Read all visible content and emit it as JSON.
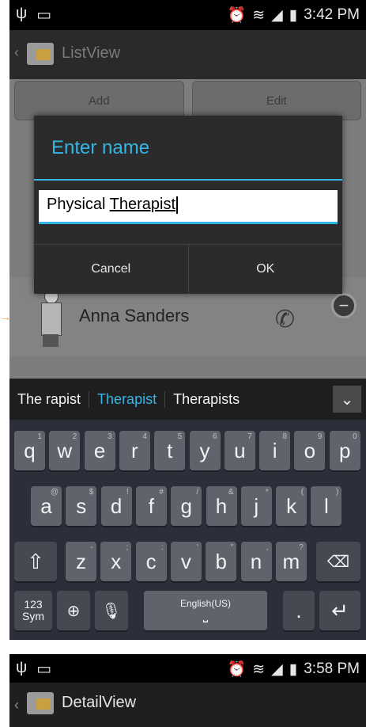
{
  "screen1": {
    "status": {
      "usb_icon": "usb-icon",
      "keyboard_icon": "keyboard-icon",
      "time": "3:42 PM"
    },
    "actionbar": {
      "title": "ListView"
    },
    "buttons": {
      "add": "Add",
      "edit": "Edit"
    },
    "list": {
      "name": "Anna Sanders"
    },
    "dialog": {
      "title": "Enter name",
      "value_prefix": "Physical ",
      "value_underlined": "Therapist",
      "cancel": "Cancel",
      "ok": "OK"
    },
    "suggestions": [
      "The rapist",
      "Therapist",
      "Therapists"
    ],
    "keyboard": {
      "row1": [
        {
          "k": "q",
          "h": "1"
        },
        {
          "k": "w",
          "h": "2"
        },
        {
          "k": "e",
          "h": "3"
        },
        {
          "k": "r",
          "h": "4"
        },
        {
          "k": "t",
          "h": "5"
        },
        {
          "k": "y",
          "h": "6"
        },
        {
          "k": "u",
          "h": "7"
        },
        {
          "k": "i",
          "h": "8"
        },
        {
          "k": "o",
          "h": "9"
        },
        {
          "k": "p",
          "h": "0"
        }
      ],
      "row2": [
        {
          "k": "a",
          "h": "@"
        },
        {
          "k": "s",
          "h": "$"
        },
        {
          "k": "d",
          "h": "!"
        },
        {
          "k": "f",
          "h": "#"
        },
        {
          "k": "g",
          "h": "/"
        },
        {
          "k": "h",
          "h": "&"
        },
        {
          "k": "j",
          "h": "*"
        },
        {
          "k": "k",
          "h": "("
        },
        {
          "k": "l",
          "h": ")"
        }
      ],
      "row3": [
        {
          "k": "z",
          "h": "-"
        },
        {
          "k": "x",
          "h": ";"
        },
        {
          "k": "c",
          "h": ":"
        },
        {
          "k": "v",
          "h": "'"
        },
        {
          "k": "b",
          "h": "\""
        },
        {
          "k": "n",
          "h": ","
        },
        {
          "k": "m",
          "h": "?"
        }
      ],
      "sym": "123\nSym",
      "space": "English(US)",
      "period": "."
    }
  },
  "screen2": {
    "status": {
      "time": "3:58 PM"
    },
    "actionbar": {
      "title": "DetailView"
    }
  }
}
